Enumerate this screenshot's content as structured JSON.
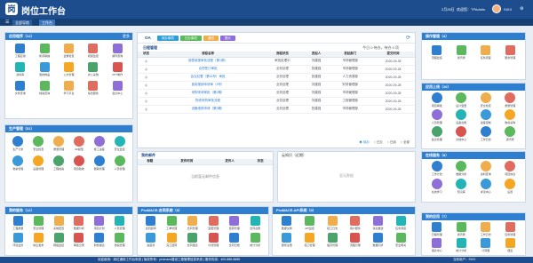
{
  "header": {
    "logo": "岗",
    "title": "岗位工作台",
    "date": "2月26日",
    "user_info": "欢迎您：TPAdmin",
    "username": "SIXX",
    "tabs": [
      "全部导航",
      "工作台"
    ]
  },
  "left": {
    "apps": {
      "title": "应用程序（12）",
      "items": [
        "工程应用",
        "新闻联播",
        "监督检查",
        "视频监控",
        "邮件查询",
        "资料库",
        "我的物品",
        "公文管理",
        "办公采购",
        "PPT制作",
        "文件查询",
        "档案查询",
        "学习平台",
        "综合服务",
        "会议中心"
      ]
    },
    "business": {
      "title": "生产管理（31）",
      "items": [
        "生产计划",
        "安全检查",
        "质量管理",
        "4D模型",
        "施工进度",
        "安全监控",
        "物资管理",
        "设备管理",
        "工程档案",
        "项目验收",
        "能耗管理",
        "人员管理"
      ]
    },
    "services": {
      "title": "我的服务（12）",
      "items": [
        "工程质量",
        "安全管理",
        "系统配置",
        "数据分析",
        "项目计划",
        "人员管理",
        "环境监测",
        "信息发布",
        "网络监控",
        "审批记录",
        "财务报表",
        "档案管理"
      ]
    }
  },
  "center": {
    "todo": {
      "title": "OA",
      "pills": [
        "待办事项",
        "已办事项",
        "通知",
        "提示"
      ],
      "subtitle": "日程管理",
      "summary": "今日 0 待办，待办 0 项",
      "headers": [
        "状态",
        "流程名称",
        "流程状态",
        "发起人",
        "发起部门",
        "提交时间"
      ],
      "rows": [
        [
          "◎",
          "报表填报审批流程（第1期）",
          "审批处理中",
          "刘建强",
          "市场管理部",
          "2020-09-28"
        ],
        [
          "◎",
          "合同签订审批",
          "业务处理",
          "张建强",
          "市场管理部",
          "2020-09-28"
        ],
        [
          "◎",
          "会议纪要（第16号）审批",
          "业务处理",
          "张建强",
          "人力资源部",
          "2020-09-28"
        ],
        [
          "◎",
          "费用报销申请单（3号）",
          "业务处理",
          "刘建强",
          "财务管理部",
          "2020-09-28"
        ],
        [
          "◎",
          "采购申请审批（第2期）",
          "业务处理",
          "刘建强",
          "市场管理部",
          "2020-09-28"
        ],
        [
          "◎",
          "物资采购审批流程",
          "业务处理",
          "刘建强",
          "工程管理部",
          "2020-09-28"
        ],
        [
          "◎",
          "设备维修申请（第3期）",
          "业务处理",
          "张建强",
          "市场管理部",
          "2020-09-28"
        ]
      ],
      "legend": [
        "待办",
        "已办",
        "已阅",
        "全部"
      ]
    },
    "mail": {
      "title": "我的邮件",
      "headers": [
        "标题",
        "发件时间",
        "发件人",
        "状态"
      ],
      "empty": "当前暂无邮件信息"
    },
    "cloud": {
      "title": "云知识（近期）",
      "empty": "暂无数据"
    },
    "products": {
      "title": "ProMACE-合同系统（9）",
      "items": [
        "合同起草",
        "工单管理",
        "合同管理",
        "变更管理",
        "结算管理",
        "合同台账",
        "进度款",
        "完工结算",
        "合同报表",
        "付款管理",
        "合同归档",
        "统计分析"
      ]
    },
    "apis": {
      "title": "ProMACE-API系统（9）",
      "items": [
        "数据交换",
        "API监控",
        "接口日志",
        "用户服务",
        "消息推送",
        "任务调度",
        "服务注册",
        "接口管理",
        "缓存管理",
        "流程引擎",
        "数据同步",
        "安全网关"
      ]
    }
  },
  "right": {
    "ops": {
      "title": "操作管理（4）",
      "items": [
        "流程监控",
        "通讯录",
        "任务调度",
        "服务管理"
      ]
    },
    "cloud": {
      "title": "应用上线（10）",
      "items": [
        "项目审批",
        "设计变更",
        "安全检查",
        "质量管理",
        "人员管理",
        "设备台账",
        "进度控制",
        "物资采购",
        "会议管理",
        "文档中心",
        "工作日志",
        "通讯录"
      ]
    },
    "tools": {
      "title": "在线服务（8）",
      "items": [
        "工作计划",
        "数据分析",
        "资料查询",
        "项目信息",
        "在线学习",
        "知识库",
        "考试中心",
        "设置"
      ]
    },
    "mine": {
      "title": "我的应用（7）",
      "items": [
        "日程管理",
        "通讯录",
        "工作日志",
        "任务管理",
        "报表中心",
        "统计分析",
        "计算器",
        "便签"
      ]
    }
  },
  "footer": {
    "text": "欢迎使用：岗位通用工作台系统 | 版权所有：promace建设工程管理信息系统 | 服务热线：400-888-8888",
    "right": "当前用户：SIXX"
  }
}
